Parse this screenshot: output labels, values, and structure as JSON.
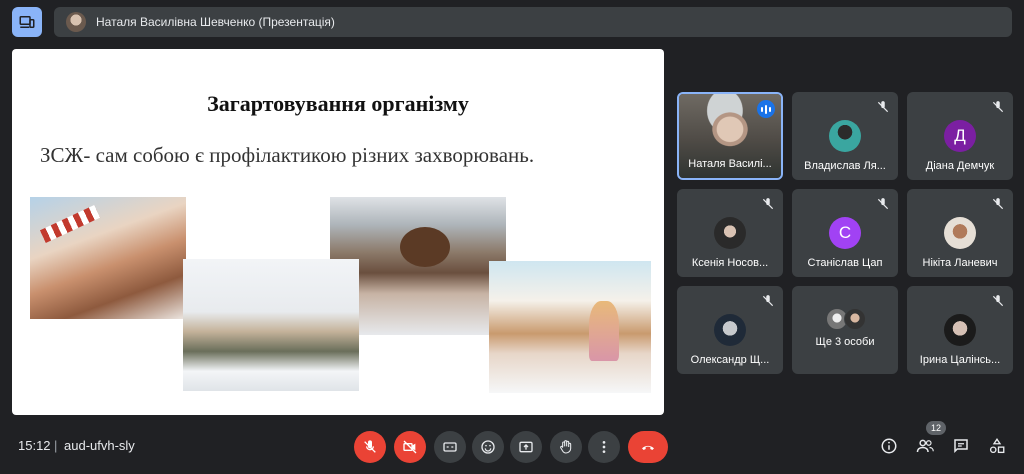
{
  "presenter_bar": {
    "label": "Наталя Василівна Шевченко (Презентація)"
  },
  "slide": {
    "title": "Загартовування організму",
    "subtitle": "ЗСЖ- сам собою є профілактикою різних захворювань."
  },
  "participants": [
    {
      "name": "Наталя Василі...",
      "type": "video",
      "speaking": true
    },
    {
      "name": "Владислав Ля...",
      "type": "photo",
      "muted": true
    },
    {
      "name": "Діана Демчук",
      "type": "letter",
      "letter": "Д",
      "color": "#7b1fa2",
      "muted": true
    },
    {
      "name": "Ксенія Носов...",
      "type": "photo",
      "muted": true
    },
    {
      "name": "Станіслав Цап",
      "type": "letter",
      "letter": "С",
      "color": "#a142f4",
      "muted": true
    },
    {
      "name": "Нікіта Ланевич",
      "type": "photo",
      "muted": true
    },
    {
      "name": "Олександр Щ...",
      "type": "photo",
      "muted": true
    },
    {
      "name": "Ще 3 особи",
      "type": "more"
    },
    {
      "name": "Ірина Цалінсь...",
      "type": "photo",
      "muted": true
    }
  ],
  "bottom": {
    "time": "15:12",
    "separator": "|",
    "meeting_code": "aud-ufvh-sly",
    "people_count": "12"
  },
  "colors": {
    "background": "#202124",
    "tile": "#3c4043",
    "danger": "#ea4335",
    "accent": "#8ab4f8"
  }
}
